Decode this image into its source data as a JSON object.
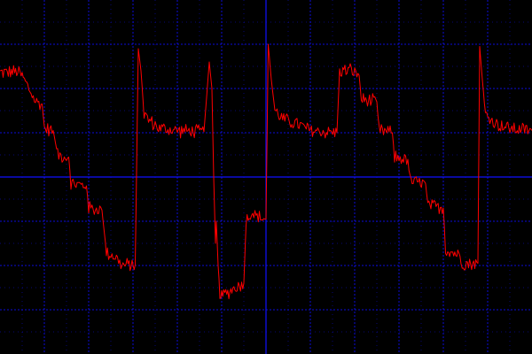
{
  "screen": {
    "background_color": "#000000",
    "grid_color": "#1010ff",
    "trace_color": "#ff0000"
  },
  "chart_data": {
    "type": "line",
    "grid": true,
    "divisions": {
      "x": 12,
      "y": 8
    },
    "xlim": [
      0,
      12
    ],
    "ylim": [
      -4,
      4
    ],
    "series": [
      {
        "noise": 0.18,
        "points": [
          [
            0.0,
            2.36
          ],
          [
            0.4,
            2.38
          ],
          [
            0.5,
            2.28
          ],
          [
            0.6,
            2.1
          ],
          [
            0.8,
            1.7
          ],
          [
            0.95,
            1.65
          ],
          [
            1.0,
            1.1
          ],
          [
            1.2,
            1.05
          ],
          [
            1.3,
            0.5
          ],
          [
            1.55,
            0.45
          ],
          [
            1.6,
            -0.15
          ],
          [
            1.95,
            -0.2
          ],
          [
            2.0,
            -0.7
          ],
          [
            2.3,
            -0.75
          ],
          [
            2.4,
            -1.7
          ],
          [
            2.6,
            -1.8
          ],
          [
            2.75,
            -2.0
          ],
          [
            3.05,
            -1.98
          ],
          [
            3.12,
            2.9
          ],
          [
            3.18,
            2.4
          ],
          [
            3.25,
            1.4
          ],
          [
            3.4,
            1.25
          ],
          [
            3.6,
            1.1
          ],
          [
            4.0,
            1.05
          ],
          [
            4.6,
            1.02
          ],
          [
            4.66,
            1.8
          ],
          [
            4.72,
            2.6
          ],
          [
            4.78,
            2.0
          ],
          [
            4.82,
            0.0
          ],
          [
            4.86,
            -1.5
          ],
          [
            4.88,
            -1.0
          ],
          [
            4.92,
            -2.0
          ],
          [
            4.96,
            -2.6
          ],
          [
            5.0,
            -2.7
          ],
          [
            5.3,
            -2.5
          ],
          [
            5.5,
            -2.4
          ],
          [
            5.55,
            -1.0
          ],
          [
            5.62,
            -0.85
          ],
          [
            5.7,
            -0.8
          ],
          [
            5.8,
            -0.9
          ],
          [
            6.0,
            -0.95
          ],
          [
            6.05,
            3.0
          ],
          [
            6.12,
            2.2
          ],
          [
            6.2,
            1.5
          ],
          [
            6.4,
            1.3
          ],
          [
            6.7,
            1.2
          ],
          [
            7.0,
            1.05
          ],
          [
            7.6,
            1.0
          ],
          [
            7.66,
            2.4
          ],
          [
            7.9,
            2.42
          ],
          [
            8.1,
            2.3
          ],
          [
            8.15,
            1.75
          ],
          [
            8.5,
            1.7
          ],
          [
            8.55,
            1.05
          ],
          [
            8.85,
            1.0
          ],
          [
            8.9,
            0.45
          ],
          [
            9.2,
            0.4
          ],
          [
            9.25,
            -0.1
          ],
          [
            9.6,
            -0.15
          ],
          [
            9.65,
            -0.65
          ],
          [
            10.0,
            -0.7
          ],
          [
            10.05,
            -1.65
          ],
          [
            10.35,
            -1.75
          ],
          [
            10.45,
            -1.95
          ],
          [
            10.78,
            -1.95
          ],
          [
            10.82,
            2.95
          ],
          [
            10.88,
            2.2
          ],
          [
            10.95,
            1.4
          ],
          [
            11.2,
            1.2
          ],
          [
            11.5,
            1.1
          ],
          [
            12.0,
            1.05
          ]
        ]
      }
    ]
  }
}
